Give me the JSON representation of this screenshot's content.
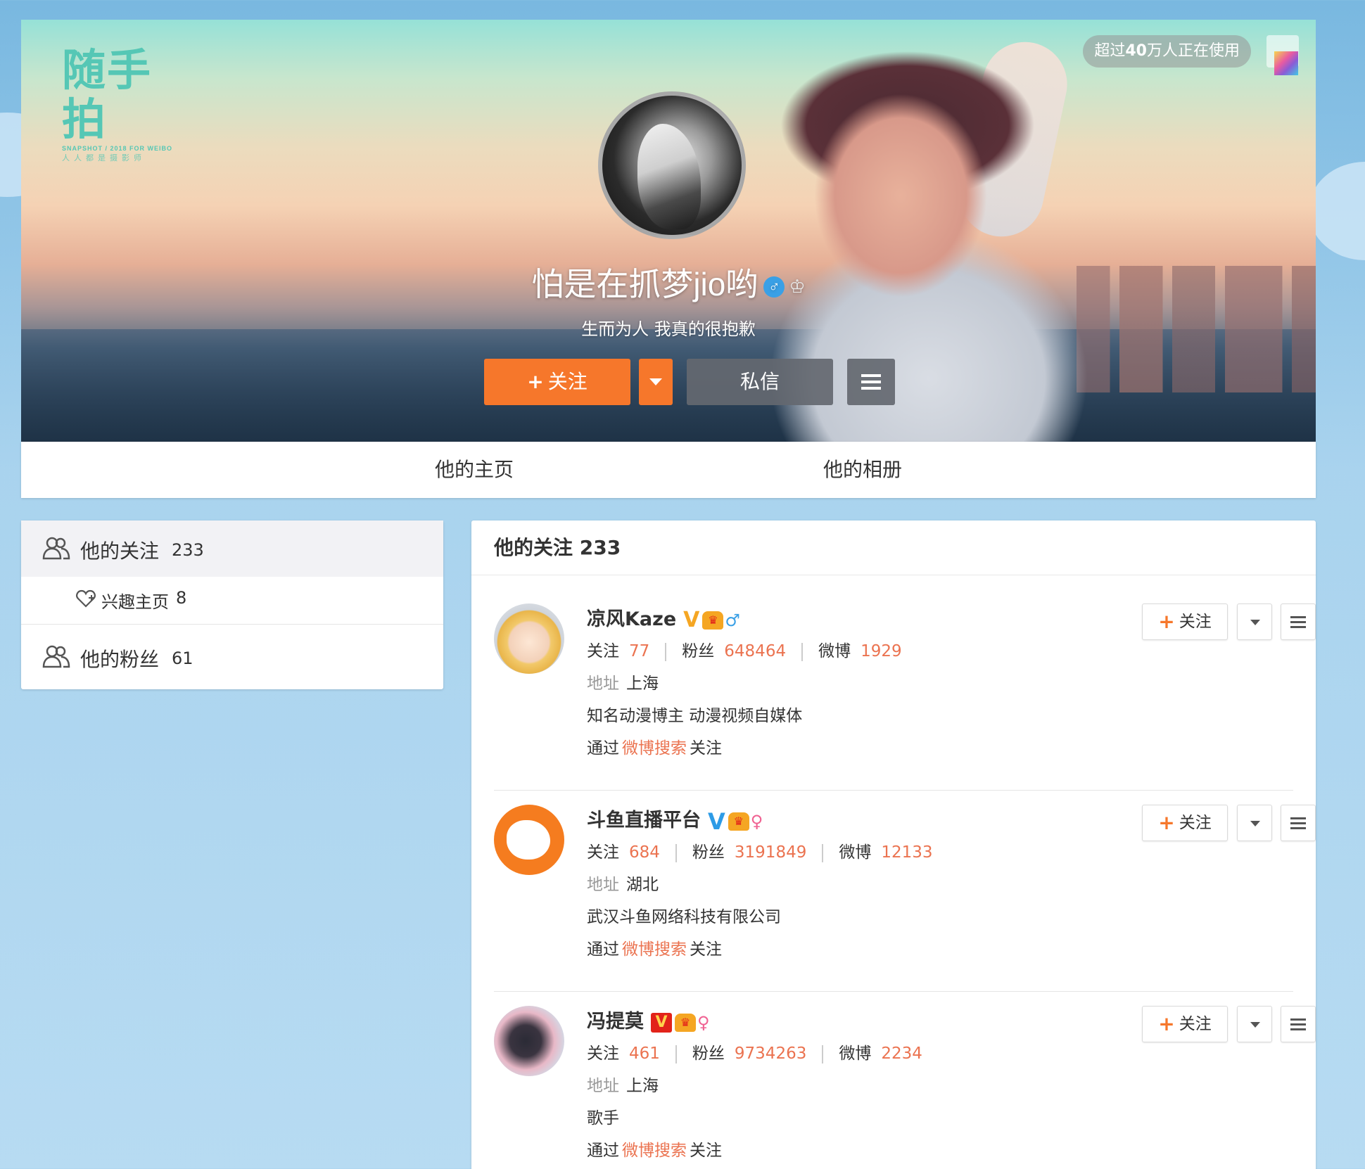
{
  "banner": {
    "logo": {
      "main": "随手拍",
      "sub1": "SNAPSHOT / 2018 FOR WEIBO",
      "sub2": "人人都是摄影师"
    },
    "usage_prefix": "超过",
    "usage_bold": "40",
    "usage_suffix": "万人正在使用"
  },
  "profile": {
    "name": "怕是在抓梦jio哟",
    "gender_icon": "♂",
    "crown_icon": "♔",
    "bio": "生而为人 我真的很抱歉",
    "follow_label": "关注",
    "follow_plus": "+",
    "message_label": "私信"
  },
  "tabs": [
    {
      "label": "他的主页"
    },
    {
      "label": "他的相册"
    }
  ],
  "sidebar": {
    "following_label": "他的关注",
    "following_count": "233",
    "interest_label": "兴趣主页",
    "interest_count": "8",
    "followers_label": "他的粉丝",
    "followers_count": "61"
  },
  "list": {
    "header": "他的关注 233",
    "users": [
      {
        "name": "凉风Kaze",
        "verify": "V",
        "vip": "♛",
        "gender": "♂",
        "following_label": "关注",
        "following": "77",
        "fans_label": "粉丝",
        "fans": "648464",
        "weibo_label": "微博",
        "weibo": "1929",
        "addr_label": "地址",
        "addr": "上海",
        "desc": "知名动漫博主 动漫视频自媒体",
        "via_prefix": "通过",
        "via_link": "微博搜索",
        "via_suffix": "关注",
        "follow_label": "关注",
        "follow_plus": "+"
      },
      {
        "name": "斗鱼直播平台",
        "verify": "V",
        "vip": "♛",
        "gender": "♀",
        "following_label": "关注",
        "following": "684",
        "fans_label": "粉丝",
        "fans": "3191849",
        "weibo_label": "微博",
        "weibo": "12133",
        "addr_label": "地址",
        "addr": "湖北",
        "desc": "武汉斗鱼网络科技有限公司",
        "via_prefix": "通过",
        "via_link": "微博搜索",
        "via_suffix": "关注",
        "follow_label": "关注",
        "follow_plus": "+"
      },
      {
        "name": "冯提莫",
        "verify": "V",
        "vip": "♛",
        "gender": "♀",
        "following_label": "关注",
        "following": "461",
        "fans_label": "粉丝",
        "fans": "9734263",
        "weibo_label": "微博",
        "weibo": "2234",
        "addr_label": "地址",
        "addr": "上海",
        "desc": "歌手",
        "via_prefix": "通过",
        "via_link": "微博搜索",
        "via_suffix": "关注",
        "follow_label": "关注",
        "follow_plus": "+"
      }
    ]
  },
  "colors": {
    "accent_orange": "#f6772b",
    "count_orange": "#eb7350",
    "verify_gold": "#f5a623",
    "verify_blue": "#2d9be6",
    "verify_red": "#e2231a",
    "bg_blue": "#b7dbf2"
  }
}
